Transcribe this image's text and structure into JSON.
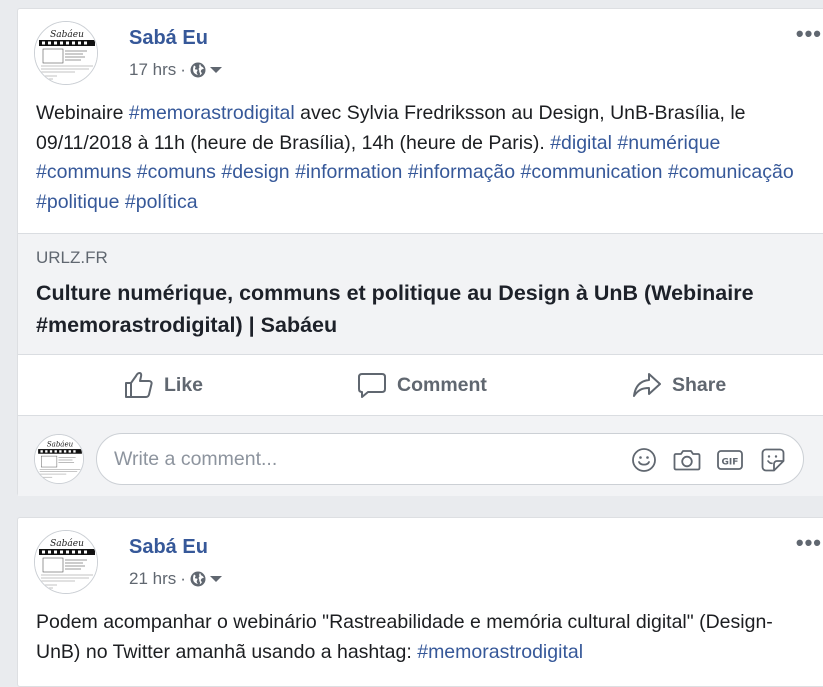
{
  "posts": [
    {
      "author": "Sabá Eu",
      "time": "17 hrs",
      "separator": "·",
      "body": [
        {
          "t": "Webinaire ",
          "h": false
        },
        {
          "t": "#memorastrodigital",
          "h": true
        },
        {
          "t": " avec Sylvia Fredriksson au Design, UnB-Brasília, le 09/11/2018 à 11h (heure de Brasília), 14h (heure de Paris). ",
          "h": false
        },
        {
          "t": "#digital",
          "h": true
        },
        {
          "t": " ",
          "h": false
        },
        {
          "t": "#numérique",
          "h": true
        },
        {
          "t": " ",
          "h": false
        },
        {
          "t": "#communs",
          "h": true
        },
        {
          "t": " ",
          "h": false
        },
        {
          "t": "#comuns",
          "h": true
        },
        {
          "t": " ",
          "h": false
        },
        {
          "t": "#design",
          "h": true
        },
        {
          "t": " ",
          "h": false
        },
        {
          "t": "#information",
          "h": true
        },
        {
          "t": " ",
          "h": false
        },
        {
          "t": "#informação",
          "h": true
        },
        {
          "t": " ",
          "h": false
        },
        {
          "t": "#communication",
          "h": true
        },
        {
          "t": " ",
          "h": false
        },
        {
          "t": "#comunicação",
          "h": true
        },
        {
          "t": " ",
          "h": false
        },
        {
          "t": "#politique",
          "h": true
        },
        {
          "t": " ",
          "h": false
        },
        {
          "t": "#política",
          "h": true
        }
      ],
      "link": {
        "domain": "URLZ.FR",
        "title": "Culture numérique, communs et politique au Design à UnB (Webinaire #memorastrodigital) | Sabáeu"
      },
      "actions": {
        "like": "Like",
        "comment": "Comment",
        "share": "Share"
      },
      "comment_box": {
        "placeholder": "Write a comment..."
      }
    },
    {
      "author": "Sabá Eu",
      "time": "21 hrs",
      "separator": "·",
      "body": [
        {
          "t": "Podem acompanhar o webinário \"Rastreabilidade e memória cultural digital\" (Design-UnB) no Twitter amanhã usando a hashtag: ",
          "h": false
        },
        {
          "t": "#memorastrodigital",
          "h": true
        }
      ]
    }
  ],
  "icons": {
    "more": "more-options-icon",
    "privacy": "globe-icon",
    "privacy_menu": "caret-down-icon",
    "like": "thumbs-up-icon",
    "comment": "speech-bubble-icon",
    "share": "share-arrow-icon",
    "emoji": "smiley-icon",
    "camera": "camera-icon",
    "gif": "gif-icon",
    "sticker": "sticker-icon"
  },
  "avatar_logo_text": "Sabáeu",
  "colors": {
    "link_blue": "#365899",
    "text": "#1c1e21",
    "secondary": "#606770",
    "page_bg": "#e9ebee",
    "card_bg": "#f2f3f5"
  }
}
